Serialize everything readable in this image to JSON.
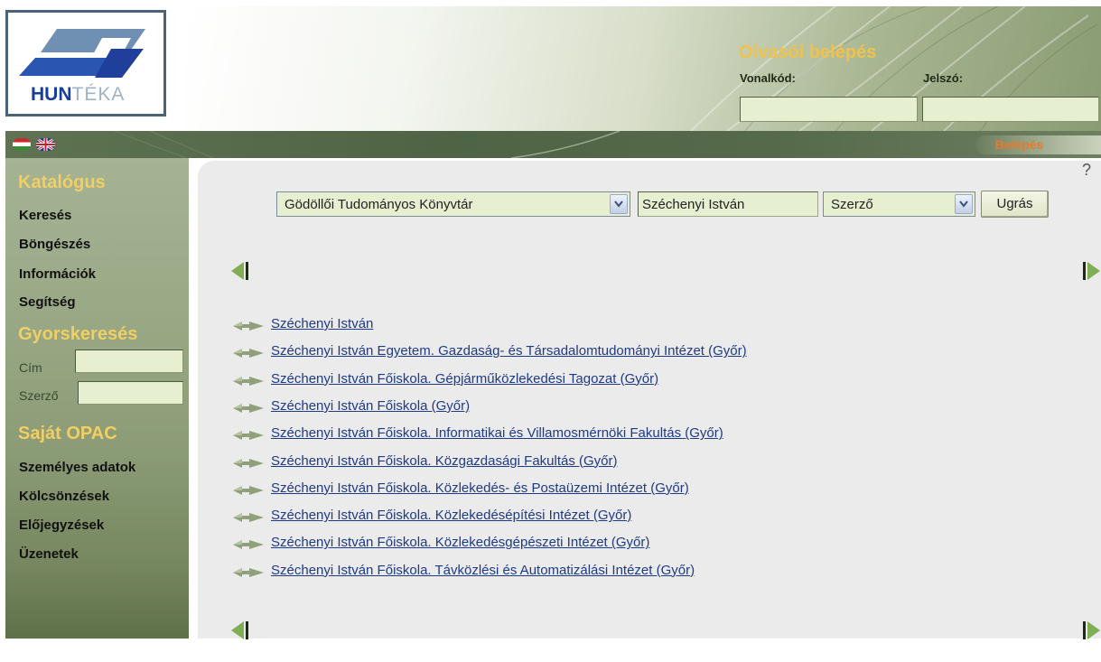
{
  "brand": {
    "logo_primary": "HUN",
    "logo_secondary": "TÉKA"
  },
  "login": {
    "title": "Olvasói belépés",
    "barcode_label": "Vonalkód:",
    "password_label": "Jelszó:",
    "barcode_value": "",
    "password_value": "",
    "submit_label": "Belépés"
  },
  "languages": [
    "hu-flag-icon",
    "uk-flag-icon"
  ],
  "sidebar": {
    "catalog_title": "Katalógus",
    "catalog_links": [
      "Keresés",
      "Böngészés",
      "Információk",
      "Segítség"
    ],
    "quick_title": "Gyorskeresés",
    "quick_title_label": "Cím",
    "quick_author_label": "Szerző",
    "quick_title_value": "",
    "quick_author_value": "",
    "opac_title": "Saját OPAC",
    "opac_links": [
      "Személyes adatok",
      "Kölcsönzések",
      "Előjegyzések",
      "Üzenetek"
    ]
  },
  "search": {
    "library": "Gödöllői Tudományos Könyvtár",
    "query": "Széchenyi István",
    "field": "Szerző",
    "go_label": "Ugrás",
    "help": "?"
  },
  "results": [
    "Széchenyi István",
    "Széchenyi István Egyetem. Gazdaság- és Társadalomtudományi Intézet (Győr)",
    "Széchenyi István Főiskola. Gépjárműközlekedési Tagozat (Győr)",
    "Széchenyi István Főiskola (Győr)",
    "Széchenyi István Főiskola. Informatikai és Villamosmérnöki Fakultás (Győr)",
    "Széchenyi István Főiskola. Közgazdasági Fakultás (Győr)",
    "Széchenyi István Főiskola. Közlekedés- és Postaüzemi Intézet (Győr)",
    "Széchenyi István Főiskola. Közlekedésépítési Intézet (Győr)",
    "Széchenyi István Főiskola. Közlekedésgépészeti Intézet (Győr)",
    "Széchenyi István Főiskola. Távközlési és Automatizálási Intézet (Győr)"
  ],
  "colors": {
    "accent_gold": "#f2ce63",
    "link_blue": "#1f3a86",
    "login_orange": "#e87a2a",
    "input_fill": "#e6efcf",
    "bar_green": "#4e6445"
  }
}
